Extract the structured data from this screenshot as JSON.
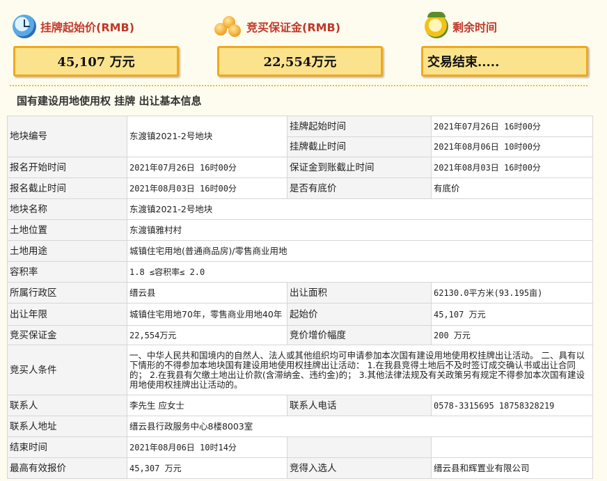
{
  "summary": {
    "start_price_label": "挂牌起始价(RMB)",
    "start_price_value": "45,107 万元",
    "deposit_label": "竞买保证金(RMB)",
    "deposit_value": "22,554万元",
    "remaining_label": "剩余时间",
    "remaining_value": "交易结束....."
  },
  "section_title": "国有建设用地使用权 挂牌 出让基本信息",
  "rows": {
    "plot_no": {
      "k": "地块编号",
      "v": "东渡镇2021-2号地块"
    },
    "list_start": {
      "k": "挂牌起始时间",
      "v": "2021年07月26日 16时00分"
    },
    "list_end": {
      "k": "挂牌截止时间",
      "v": "2021年08月06日 10时00分"
    },
    "reg_start": {
      "k": "报名开始时间",
      "v": "2021年07月26日 16时00分"
    },
    "deposit_deadline": {
      "k": "保证金到账截止时间",
      "v": "2021年08月03日 16时00分"
    },
    "reg_end": {
      "k": "报名截止时间",
      "v": "2021年08月03日 16时00分"
    },
    "reserve": {
      "k": "是否有底价",
      "v": "有底价"
    },
    "plot_name": {
      "k": "地块名称",
      "v": "东渡镇2021-2号地块"
    },
    "location": {
      "k": "土地位置",
      "v": "东渡镇雅村村"
    },
    "usage": {
      "k": "土地用途",
      "v": "城镇住宅用地(普通商品房)/零售商业用地"
    },
    "far": {
      "k": "容积率",
      "v": "1.8 ≤容积率≤ 2.0"
    },
    "district": {
      "k": "所属行政区",
      "v": "缙云县"
    },
    "area": {
      "k": "出让面积",
      "v": "62130.0平方米(93.195亩)"
    },
    "term": {
      "k": "出让年限",
      "v": "城镇住宅用地70年，零售商业用地40年"
    },
    "start_price": {
      "k": "起始价",
      "v": "45,107 万元"
    },
    "bid_deposit": {
      "k": "竞买保证金",
      "v": "22,554万元"
    },
    "increment": {
      "k": "竞价增价幅度",
      "v": "200 万元"
    },
    "conditions": {
      "k": "竞买人条件",
      "v": "一、中华人民共和国境内的自然人、法人或其他组织均可申请参加本次国有建设用地使用权挂牌出让活动。 二、具有以下情形的不得参加本地块国有建设用地使用权挂牌出让活动： 1.在我县竞得土地后不及时签订成交确认书或出让合同的； 2.在我县有欠缴土地出让价款(含滞纳金、违约金)的； 3.其他法律法规及有关政策另有规定不得参加本次国有建设用地使用权挂牌出让活动的。"
    },
    "contact": {
      "k": "联系人",
      "v": "李先生 应女士"
    },
    "phone": {
      "k": "联系人电话",
      "v": "0578-3315695 18758328219"
    },
    "address": {
      "k": "联系人地址",
      "v": "缙云县行政服务中心8楼8003室"
    },
    "end_time": {
      "k": "结束时间",
      "v": "2021年08月06日 10时14分"
    },
    "top_bid": {
      "k": "最高有效报价",
      "v": "45,307 万元"
    },
    "winner": {
      "k": "竞得入选人",
      "v": "缙云县和辉置业有限公司"
    }
  },
  "colors": {
    "label_red": "#c0392b",
    "box_fill": "#fbe38e",
    "box_border": "#f1a81a",
    "page_bg": "#fefcef"
  }
}
